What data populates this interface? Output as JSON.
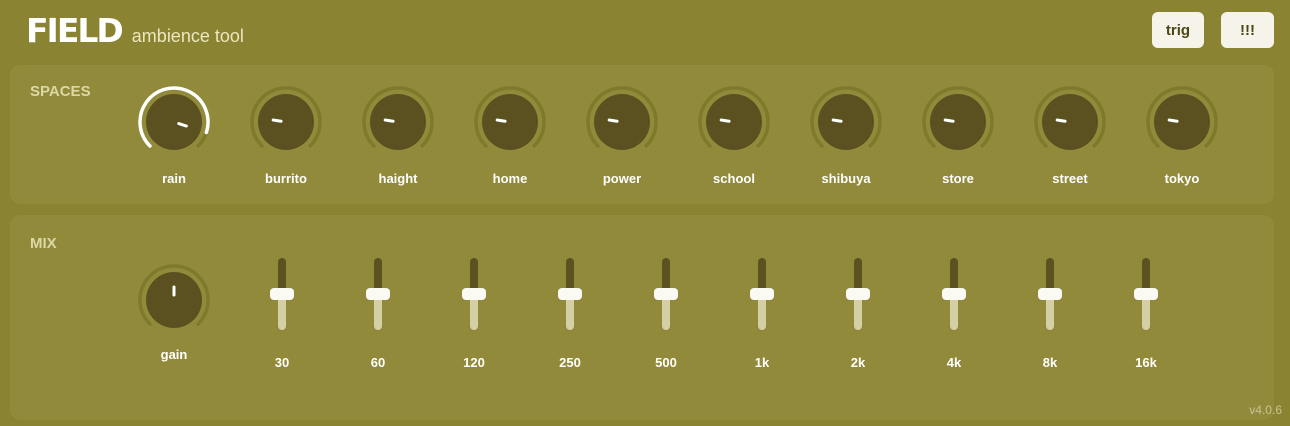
{
  "header": {
    "logo": "FIELD",
    "subtitle": "ambience tool",
    "trig_label": "trig",
    "alert_label": "!!!"
  },
  "spaces": {
    "title": "SPACES",
    "knobs": [
      {
        "label": "rain",
        "value": 0.9,
        "active": true
      },
      {
        "label": "burrito",
        "value": 0.2,
        "active": false
      },
      {
        "label": "haight",
        "value": 0.2,
        "active": false
      },
      {
        "label": "home",
        "value": 0.2,
        "active": false
      },
      {
        "label": "power",
        "value": 0.2,
        "active": false
      },
      {
        "label": "school",
        "value": 0.2,
        "active": false
      },
      {
        "label": "shibuya",
        "value": 0.2,
        "active": false
      },
      {
        "label": "store",
        "value": 0.2,
        "active": false
      },
      {
        "label": "street",
        "value": 0.2,
        "active": false
      },
      {
        "label": "tokyo",
        "value": 0.2,
        "active": false
      }
    ]
  },
  "mix": {
    "title": "MIX",
    "gain": {
      "label": "gain",
      "value": 0.5
    },
    "eq": [
      {
        "label": "30",
        "value": 0.5
      },
      {
        "label": "60",
        "value": 0.5
      },
      {
        "label": "120",
        "value": 0.5
      },
      {
        "label": "250",
        "value": 0.5
      },
      {
        "label": "500",
        "value": 0.5
      },
      {
        "label": "1k",
        "value": 0.5
      },
      {
        "label": "2k",
        "value": 0.5
      },
      {
        "label": "4k",
        "value": 0.5
      },
      {
        "label": "8k",
        "value": 0.5
      },
      {
        "label": "16k",
        "value": 0.5
      }
    ]
  },
  "version": "v4.0.6",
  "colors": {
    "background": "#8a8332",
    "panel": "#918a3a",
    "knob_body": "#5b5120",
    "knob_ring_inactive": "#7e7a2c",
    "knob_ring_active": "#ffffff",
    "button_bg": "#f6f4ea"
  }
}
